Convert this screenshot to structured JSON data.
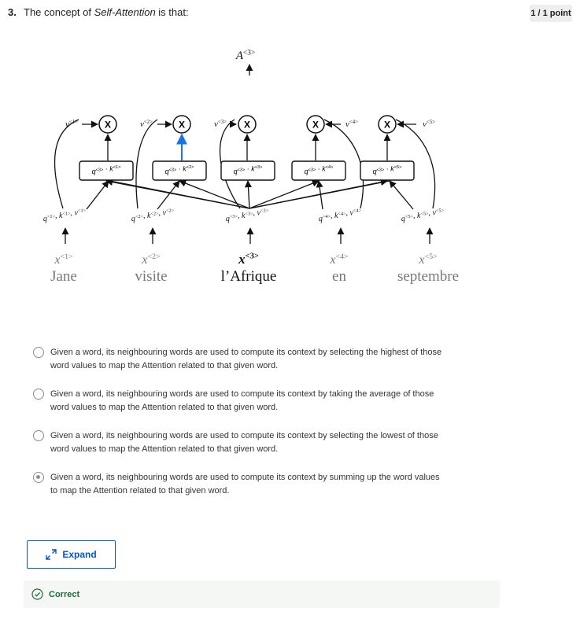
{
  "question": {
    "number": "3.",
    "text_before": "The concept of ",
    "text_italic": "Self-Attention",
    "text_after": " is that:",
    "points": "1 / 1 point"
  },
  "diagram": {
    "output_label": "A<3>",
    "value_labels": [
      "v<1>",
      "v<2>",
      "v<3>",
      "v<4>",
      "v<5>"
    ],
    "score_labels": [
      "q<3> · k<1>",
      "q<3> · k<2>",
      "q<3> · k<3>",
      "q<3> · k<4>",
      "q<3> · k<5>"
    ],
    "multiply_symbol": "X",
    "qkv_labels": [
      "q<1>, k<1>, v<1>",
      "q<2>, k<2>, v<2>",
      "q<3>, k<3>, v<3>",
      "q<4>, k<4>, v<4>",
      "q<5>, k<5>, v<5>"
    ],
    "x_labels": [
      "x<1>",
      "x<2>",
      "x<3>",
      "x<4>",
      "x<5>"
    ],
    "words": [
      "Jane",
      "visite",
      "l’Afrique",
      "en",
      "septembre"
    ]
  },
  "options": [
    {
      "text": "Given a word, its neighbouring words are used to compute its context by selecting the highest of those word values to map the Attention related to that given word.",
      "selected": false
    },
    {
      "text": "Given a word, its neighbouring words are used to compute its context by taking the average of those word values to map the Attention related to that given word.",
      "selected": false
    },
    {
      "text": "Given a word, its neighbouring words are used to compute its context by selecting the lowest of those word values to map the Attention related to that given word.",
      "selected": false
    },
    {
      "text": "Given a word, its neighbouring words are used to compute its context by summing up the word values to map the Attention related to that given word.",
      "selected": true
    }
  ],
  "expand_label": "Expand",
  "feedback": {
    "label": "Correct",
    "icon": "check-circle-icon"
  },
  "colors": {
    "accent": "#0056d2",
    "correct": "#1e6b3a",
    "highlight_arrow": "#1a73e8"
  }
}
